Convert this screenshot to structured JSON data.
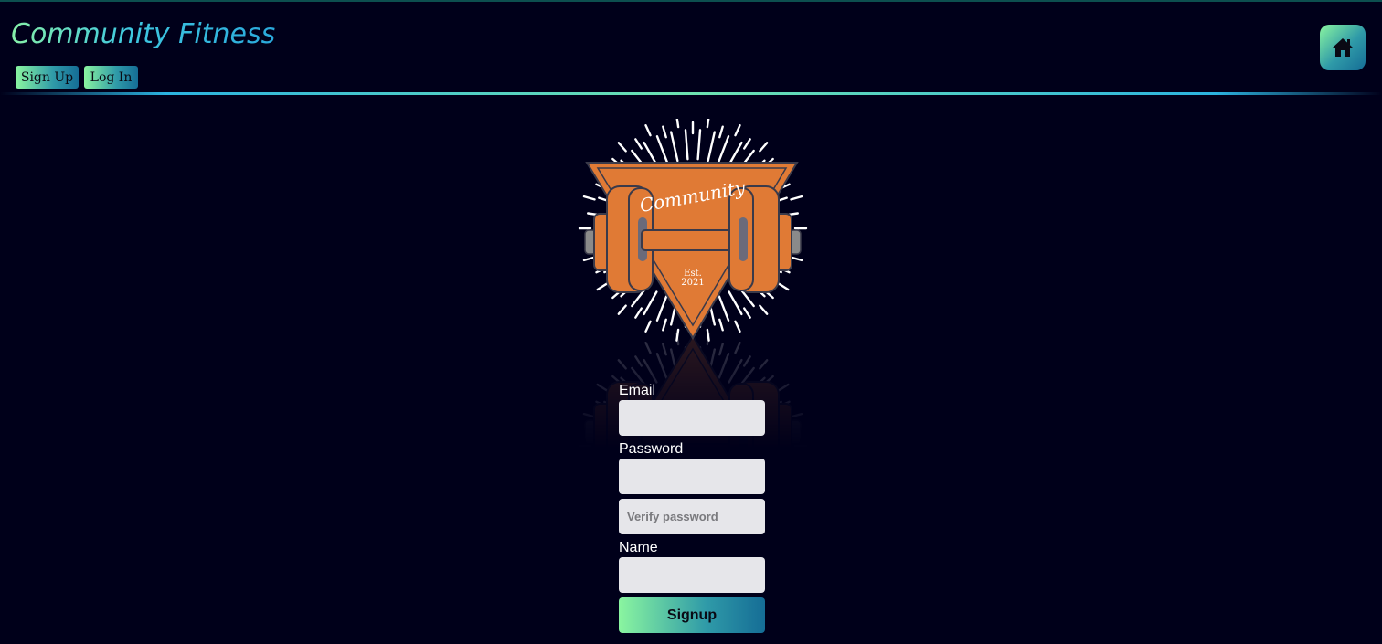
{
  "header": {
    "title": "Community Fitness",
    "nav": {
      "signup_label": "Sign Up",
      "login_label": "Log In"
    },
    "home_icon": "home-icon"
  },
  "logo": {
    "banner_text": "Community",
    "est_label": "Est.",
    "est_year": "2021"
  },
  "form": {
    "email_label": "Email",
    "email_value": "",
    "password_label": "Password",
    "password_value": "",
    "verify_placeholder": "Verify password",
    "name_label": "Name",
    "name_value": "",
    "submit_label": "Signup"
  },
  "colors": {
    "background": "#00001a",
    "accent_start": "#8af5a0",
    "accent_end": "#156d96",
    "logo_orange": "#e07a35"
  }
}
